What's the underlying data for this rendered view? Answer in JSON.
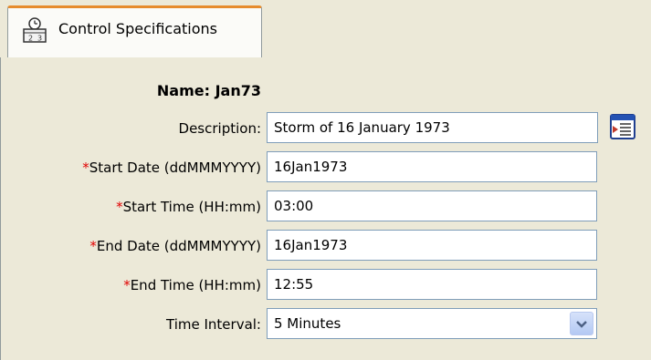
{
  "tab": {
    "label": "Control Specifications",
    "icon": "calendar-clock-icon"
  },
  "form": {
    "name_label": "Name:",
    "name_value": "Jan73",
    "description": {
      "label": "Description:",
      "value": "Storm of 16 January 1973",
      "button_icon": "edit-description-icon"
    },
    "start_date": {
      "required_marker": "*",
      "label": "Start Date (ddMMMYYYY)",
      "value": "16Jan1973"
    },
    "start_time": {
      "required_marker": "*",
      "label": "Start Time (HH:mm)",
      "value": "03:00"
    },
    "end_date": {
      "required_marker": "*",
      "label": "End Date (ddMMMYYYY)",
      "value": "16Jan1973"
    },
    "end_time": {
      "required_marker": "*",
      "label": "End Time (HH:mm)",
      "value": "12:55"
    },
    "time_interval": {
      "label": "Time Interval:",
      "value": "5 Minutes"
    }
  },
  "colors": {
    "panel_bg": "#ece9d8",
    "tab_accent": "#e68b2c",
    "required": "#e00000",
    "field_border": "#7f9db9"
  }
}
